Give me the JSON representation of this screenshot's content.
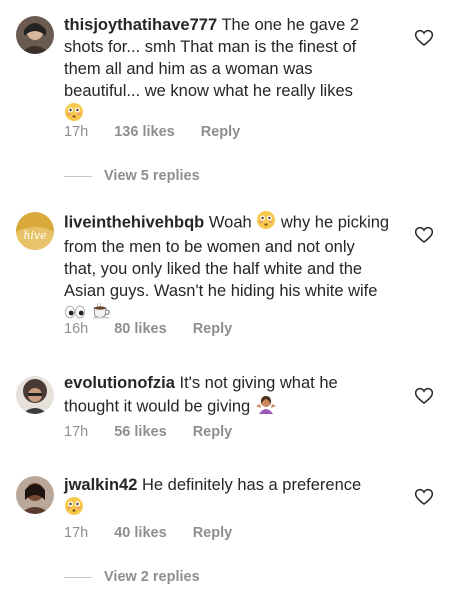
{
  "comments": [
    {
      "username": "thisjoythatihave777",
      "text": "The one he gave 2 shots for... smh That man is the finest of them all and him as a woman was beautiful... we know what he really likes",
      "emoji": "flushed-face",
      "time": "17h",
      "likes": "136 likes",
      "reply": "Reply",
      "view_replies": "View 5 replies"
    },
    {
      "username": "liveinthehivehbqb",
      "text": "Woah",
      "text2": "why he picking from the men to be women and not only that, you only liked the half white and the Asian guys. Wasn't he hiding his white wife",
      "emoji": "flushed-face",
      "time": "16h",
      "likes": "80 likes",
      "reply": "Reply"
    },
    {
      "username": "evolutionofzia",
      "text": "It's not giving what he thought it would be giving",
      "emoji": "woman-shrugging",
      "time": "17h",
      "likes": "56 likes",
      "reply": "Reply"
    },
    {
      "username": "jwalkin42",
      "text": "He definitely has a preference",
      "emoji": "flushed-face",
      "time": "17h",
      "likes": "40 likes",
      "reply": "Reply",
      "view_replies": "View 2 replies"
    }
  ]
}
